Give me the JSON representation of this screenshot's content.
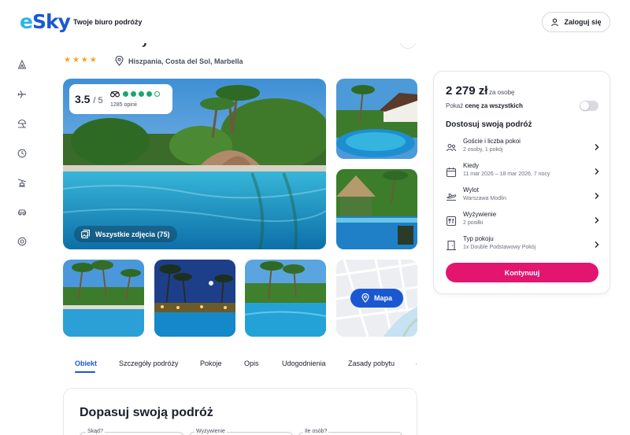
{
  "header": {
    "logo": "eSky",
    "tagline": "Twoje biuro podróży",
    "login_label": "Zaloguj się"
  },
  "rail": {
    "icons": [
      "camping-icon",
      "plane-icon",
      "beach-umbrella-icon",
      "clock-icon",
      "ski-lift-icon",
      "car-icon",
      "life-ring-icon"
    ]
  },
  "hotel": {
    "title_fragment": "y",
    "stars": "★★★★",
    "location": "Hiszpania, Costa del Sol, Marbella"
  },
  "gallery": {
    "rating_score": "3.5",
    "rating_max": "/ 5",
    "reviews": "1285 opinii",
    "rating_dots_filled": 4,
    "rating_dots_total": 5,
    "all_photos_label": "Wszystkie zdjęcia (75)",
    "map_label": "Mapa"
  },
  "tabs": [
    "Obiekt",
    "Szczegóły podróży",
    "Pokoje",
    "Opis",
    "Udogodnienia",
    "Zasady pobytu"
  ],
  "adjust": {
    "title": "Dopasuj swoją podróż",
    "fields": [
      "Skąd?",
      "Wyżywienie",
      "Ile osób?"
    ]
  },
  "booking": {
    "price": "2 279 zł",
    "per": "za osobę",
    "toggle_prefix": "Pokaż ",
    "toggle_bold": "cenę za wszystkich",
    "section_title": "Dostosuj swoją podróż",
    "options": [
      {
        "icon": "guests-icon",
        "title": "Goście i liczba pokoi",
        "sub": "2 osoby, 1 pokój"
      },
      {
        "icon": "calendar-icon",
        "title": "Kiedy",
        "sub": "11 mar 2026 – 18 mar 2026, 7 nocy"
      },
      {
        "icon": "departure-icon",
        "title": "Wylot",
        "sub": "Warszawa Modlin"
      },
      {
        "icon": "meals-icon",
        "title": "Wyżywienie",
        "sub": "2 posiłki"
      },
      {
        "icon": "room-icon",
        "title": "Typ pokoju",
        "sub": "1x Double Podstawowy Pokój"
      }
    ],
    "cta": "Kontynuuj"
  },
  "colors": {
    "brand_blue": "#1a58d1",
    "cta_pink": "#e3156f",
    "rating_green": "#1ba672",
    "star": "#f2a51a"
  }
}
